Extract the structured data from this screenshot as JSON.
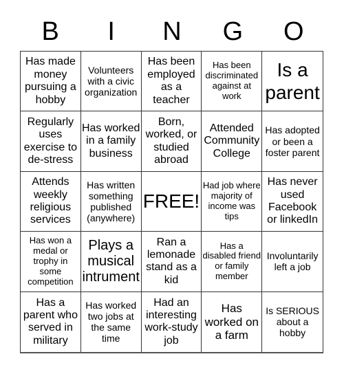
{
  "header": [
    "B",
    "I",
    "N",
    "G",
    "O"
  ],
  "cells": [
    "Has made money pursuing a hobby",
    "Volunteers with a civic organization",
    "Has been employed as a teacher",
    "Has been discriminated against at work",
    "Is a parent",
    "Regularly uses exercise to de-stress",
    "Has worked in a family business",
    "Born, worked, or studied abroad",
    "Attended Community College",
    "Has adopted or been a foster parent",
    "Attends weekly religious services",
    "Has written something published (anywhere)",
    "FREE!",
    "Had job where majority of income was tips",
    "Has never used Facebook or linkedIn",
    "Has won a medal or trophy in some competition",
    "Plays a musical intrument",
    "Ran a lemonade stand as a kid",
    "Has a disabled friend or family member",
    "Involuntarily left a job",
    "Has a parent who served in military",
    "Has worked two jobs at the same time",
    "Had an interesting work-study job",
    "Has worked on a farm",
    "Is SERIOUS about a hobby"
  ]
}
